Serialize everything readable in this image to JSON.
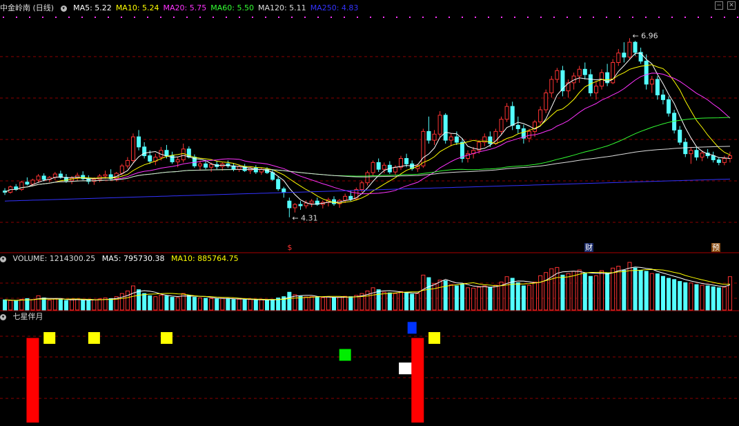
{
  "price_panel": {
    "title": "中金岭南 (日线)",
    "indicators": [
      {
        "label": "MA5: 5.22",
        "color": "#ffffff"
      },
      {
        "label": "MA10: 5.24",
        "color": "#ffff00"
      },
      {
        "label": "MA20: 5.75",
        "color": "#ff33ff"
      },
      {
        "label": "MA60: 5.50",
        "color": "#33ff33"
      },
      {
        "label": "MA120: 5.11",
        "color": "#dddddd"
      },
      {
        "label": "MA250: 4.83",
        "color": "#3333ff"
      }
    ],
    "high_label": "6.96",
    "low_label": "4.31",
    "marker_cai": "财",
    "marker_yu": "预"
  },
  "volume_panel": {
    "title": "VOLUME: 1214300.25",
    "ma5": "MA5: 795730.38",
    "ma10": "MA10: 885764.75"
  },
  "indicator_panel": {
    "title": "七星伴月"
  },
  "colors": {
    "up": "#ff3333",
    "down": "#54ffff",
    "grid": "#8b0000",
    "ma5": "#ffffff",
    "ma10": "#ffff00",
    "ma20": "#ff33ff",
    "ma60": "#33ff33",
    "ma120": "#dddddd",
    "ma250": "#3333ff"
  },
  "chart_data": [
    {
      "type": "candlestick",
      "title": "中金岭南 (日线)",
      "ylim": [
        4.0,
        7.3
      ],
      "annotations": [
        {
          "label": "6.96",
          "value": 6.96
        },
        {
          "label": "4.31",
          "value": 4.31
        }
      ],
      "candles": [
        [
          4.7,
          4.74,
          4.64,
          4.68
        ],
        [
          4.68,
          4.78,
          4.66,
          4.76
        ],
        [
          4.76,
          4.8,
          4.7,
          4.72
        ],
        [
          4.72,
          4.85,
          4.7,
          4.83
        ],
        [
          4.83,
          4.9,
          4.78,
          4.8
        ],
        [
          4.8,
          4.88,
          4.77,
          4.86
        ],
        [
          4.86,
          4.95,
          4.82,
          4.92
        ],
        [
          4.92,
          4.96,
          4.84,
          4.87
        ],
        [
          4.87,
          4.92,
          4.83,
          4.9
        ],
        [
          4.9,
          4.98,
          4.86,
          4.95
        ],
        [
          4.95,
          5.0,
          4.88,
          4.9
        ],
        [
          4.9,
          4.95,
          4.82,
          4.85
        ],
        [
          4.85,
          4.92,
          4.8,
          4.89
        ],
        [
          4.89,
          4.97,
          4.85,
          4.93
        ],
        [
          4.93,
          4.99,
          4.86,
          4.88
        ],
        [
          4.88,
          4.93,
          4.8,
          4.84
        ],
        [
          4.84,
          4.9,
          4.79,
          4.87
        ],
        [
          4.87,
          4.95,
          4.83,
          4.92
        ],
        [
          4.92,
          5.0,
          4.88,
          4.94
        ],
        [
          4.94,
          5.02,
          4.85,
          4.88
        ],
        [
          4.88,
          4.98,
          4.84,
          4.96
        ],
        [
          4.96,
          5.1,
          4.93,
          5.07
        ],
        [
          5.07,
          5.2,
          5.03,
          5.15
        ],
        [
          5.15,
          5.55,
          5.12,
          5.5
        ],
        [
          5.5,
          5.6,
          5.3,
          5.35
        ],
        [
          5.35,
          5.42,
          5.18,
          5.22
        ],
        [
          5.22,
          5.3,
          5.1,
          5.14
        ],
        [
          5.14,
          5.25,
          5.08,
          5.2
        ],
        [
          5.2,
          5.35,
          5.15,
          5.3
        ],
        [
          5.3,
          5.38,
          5.18,
          5.22
        ],
        [
          5.22,
          5.28,
          5.1,
          5.13
        ],
        [
          5.13,
          5.2,
          5.05,
          5.16
        ],
        [
          5.16,
          5.4,
          5.12,
          5.32
        ],
        [
          5.32,
          5.36,
          5.18,
          5.2
        ],
        [
          5.2,
          5.24,
          5.04,
          5.07
        ],
        [
          5.07,
          5.15,
          5.0,
          5.1
        ],
        [
          5.1,
          5.16,
          5.02,
          5.05
        ],
        [
          5.05,
          5.12,
          4.98,
          5.09
        ],
        [
          5.09,
          5.14,
          5.02,
          5.06
        ],
        [
          5.06,
          5.12,
          5.0,
          5.1
        ],
        [
          5.1,
          5.15,
          5.04,
          5.07
        ],
        [
          5.07,
          5.11,
          4.99,
          5.02
        ],
        [
          5.02,
          5.09,
          4.98,
          5.06
        ],
        [
          5.06,
          5.1,
          4.98,
          5.0
        ],
        [
          5.0,
          5.06,
          4.95,
          5.04
        ],
        [
          5.04,
          5.08,
          4.95,
          4.98
        ],
        [
          4.98,
          5.04,
          4.94,
          5.02
        ],
        [
          5.02,
          5.05,
          4.95,
          4.97
        ],
        [
          4.97,
          5.02,
          4.85,
          4.87
        ],
        [
          4.87,
          4.92,
          4.7,
          4.73
        ],
        [
          4.73,
          4.76,
          4.6,
          4.68
        ],
        [
          4.55,
          4.6,
          4.31,
          4.45
        ],
        [
          4.45,
          4.52,
          4.38,
          4.5
        ],
        [
          4.5,
          4.55,
          4.42,
          4.48
        ],
        [
          4.48,
          4.56,
          4.44,
          4.52
        ],
        [
          4.52,
          4.58,
          4.46,
          4.55
        ],
        [
          4.55,
          4.6,
          4.48,
          4.5
        ],
        [
          4.5,
          4.56,
          4.44,
          4.53
        ],
        [
          4.53,
          4.6,
          4.47,
          4.57
        ],
        [
          4.57,
          4.62,
          4.48,
          4.51
        ],
        [
          4.51,
          4.58,
          4.45,
          4.56
        ],
        [
          4.56,
          4.66,
          4.52,
          4.62
        ],
        [
          4.62,
          4.7,
          4.55,
          4.58
        ],
        [
          4.58,
          4.75,
          4.56,
          4.72
        ],
        [
          4.72,
          4.85,
          4.68,
          4.82
        ],
        [
          4.82,
          5.0,
          4.78,
          4.97
        ],
        [
          4.97,
          5.15,
          4.92,
          5.12
        ],
        [
          5.12,
          5.18,
          4.98,
          5.02
        ],
        [
          5.02,
          5.12,
          4.96,
          5.08
        ],
        [
          5.08,
          5.14,
          4.95,
          4.98
        ],
        [
          4.98,
          5.08,
          4.94,
          5.05
        ],
        [
          5.05,
          5.22,
          5.01,
          5.18
        ],
        [
          5.18,
          5.25,
          5.05,
          5.1
        ],
        [
          5.1,
          5.15,
          5.0,
          5.03
        ],
        [
          5.03,
          5.1,
          4.98,
          5.07
        ],
        [
          5.07,
          5.62,
          5.04,
          5.58
        ],
        [
          5.58,
          5.8,
          5.4,
          5.45
        ],
        [
          5.45,
          5.6,
          5.38,
          5.54
        ],
        [
          5.54,
          5.88,
          5.5,
          5.82
        ],
        [
          5.82,
          5.85,
          5.4,
          5.45
        ],
        [
          5.45,
          5.55,
          5.36,
          5.5
        ],
        [
          5.5,
          5.58,
          5.38,
          5.42
        ],
        [
          5.42,
          5.48,
          5.12,
          5.18
        ],
        [
          5.18,
          5.3,
          5.12,
          5.25
        ],
        [
          5.25,
          5.35,
          5.18,
          5.3
        ],
        [
          5.3,
          5.45,
          5.25,
          5.42
        ],
        [
          5.42,
          5.55,
          5.36,
          5.5
        ],
        [
          5.5,
          5.58,
          5.35,
          5.4
        ],
        [
          5.4,
          5.62,
          5.38,
          5.58
        ],
        [
          5.58,
          5.8,
          5.54,
          5.76
        ],
        [
          5.76,
          6.0,
          5.72,
          5.95
        ],
        [
          5.95,
          6.02,
          5.6,
          5.67
        ],
        [
          5.67,
          5.8,
          5.55,
          5.62
        ],
        [
          5.62,
          5.68,
          5.4,
          5.48
        ],
        [
          5.48,
          5.62,
          5.42,
          5.58
        ],
        [
          5.58,
          5.75,
          5.5,
          5.72
        ],
        [
          5.72,
          5.95,
          5.68,
          5.9
        ],
        [
          5.9,
          6.2,
          5.85,
          6.15
        ],
        [
          6.15,
          6.4,
          6.08,
          6.35
        ],
        [
          6.35,
          6.52,
          6.3,
          6.48
        ],
        [
          6.48,
          6.55,
          6.1,
          6.18
        ],
        [
          6.18,
          6.35,
          6.08,
          6.3
        ],
        [
          6.3,
          6.45,
          6.2,
          6.4
        ],
        [
          6.4,
          6.55,
          6.3,
          6.5
        ],
        [
          6.5,
          6.6,
          6.35,
          6.42
        ],
        [
          6.42,
          6.5,
          6.1,
          6.15
        ],
        [
          6.15,
          6.32,
          6.05,
          6.25
        ],
        [
          6.25,
          6.5,
          6.2,
          6.45
        ],
        [
          6.45,
          6.58,
          6.25,
          6.3
        ],
        [
          6.3,
          6.65,
          6.28,
          6.6
        ],
        [
          6.6,
          6.8,
          6.55,
          6.74
        ],
        [
          6.74,
          6.9,
          6.6,
          6.68
        ],
        [
          6.68,
          6.96,
          6.65,
          6.9
        ],
        [
          6.9,
          6.92,
          6.7,
          6.75
        ],
        [
          6.75,
          6.82,
          6.58,
          6.62
        ],
        [
          6.62,
          6.72,
          6.2,
          6.28
        ],
        [
          6.28,
          6.4,
          6.15,
          6.35
        ],
        [
          6.35,
          6.4,
          6.05,
          6.12
        ],
        [
          6.12,
          6.2,
          5.98,
          6.05
        ],
        [
          6.05,
          6.1,
          5.8,
          5.85
        ],
        [
          5.85,
          5.9,
          5.55,
          5.6
        ],
        [
          5.6,
          5.66,
          5.38,
          5.42
        ],
        [
          5.42,
          5.48,
          5.2,
          5.25
        ],
        [
          5.25,
          5.35,
          5.1,
          5.3
        ],
        [
          5.3,
          5.36,
          5.15,
          5.2
        ],
        [
          5.2,
          5.3,
          5.14,
          5.26
        ],
        [
          5.26,
          5.32,
          5.18,
          5.22
        ],
        [
          5.22,
          5.28,
          5.12,
          5.16
        ],
        [
          5.16,
          5.2,
          5.08,
          5.12
        ],
        [
          5.12,
          5.22,
          5.08,
          5.18
        ],
        [
          5.18,
          5.28,
          5.12,
          5.22
        ]
      ],
      "series": [
        {
          "name": "MA5",
          "value": 5.22
        },
        {
          "name": "MA10",
          "value": 5.24
        },
        {
          "name": "MA20",
          "value": 5.75
        },
        {
          "name": "MA60",
          "value": 5.5
        },
        {
          "name": "MA120",
          "value": 5.11
        },
        {
          "name": "MA250",
          "value": 4.83
        }
      ]
    },
    {
      "type": "bar",
      "title": "VOLUME: 1214300.25",
      "ylim": [
        0,
        1500000
      ],
      "series": [
        {
          "name": "MA5",
          "value": 795730.38
        },
        {
          "name": "MA10",
          "value": 885764.75
        }
      ],
      "values": [
        320000,
        300000,
        290000,
        340000,
        360000,
        330000,
        450000,
        380000,
        310000,
        350000,
        330000,
        300000,
        320000,
        340000,
        310000,
        300000,
        320000,
        350000,
        380000,
        360000,
        420000,
        520000,
        600000,
        760000,
        640000,
        520000,
        450000,
        420000,
        470000,
        440000,
        400000,
        390000,
        520000,
        460000,
        400000,
        380000,
        370000,
        360000,
        350000,
        370000,
        360000,
        330000,
        340000,
        320000,
        330000,
        310000,
        320000,
        300000,
        330000,
        380000,
        420000,
        560000,
        480000,
        430000,
        410000,
        420000,
        400000,
        390000,
        410000,
        380000,
        400000,
        430000,
        420000,
        460000,
        520000,
        600000,
        700000,
        640000,
        560000,
        540000,
        520000,
        580000,
        540000,
        500000,
        520000,
        1100000,
        1020000,
        840000,
        940000,
        920000,
        800000,
        760000,
        820000,
        700000,
        690000,
        720000,
        760000,
        720000,
        780000,
        880000,
        1050000,
        1000000,
        860000,
        760000,
        780000,
        880000,
        1080000,
        1180000,
        1300000,
        1340000,
        1100000,
        1150000,
        1220000,
        1260000,
        1150000,
        1060000,
        1080000,
        1240000,
        1160000,
        1320000,
        1380000,
        1250000,
        1500000,
        1320000,
        1250000,
        1220000,
        1150000,
        1140000,
        1060000,
        1000000,
        960000,
        900000,
        860000,
        850000,
        800000,
        780000,
        760000,
        730000,
        700000,
        720000,
        1050000
      ]
    },
    {
      "type": "bar",
      "title": "七星伴月",
      "ylim": [
        0,
        120
      ],
      "points": [
        {
          "x": 5,
          "y": 100,
          "color": "red"
        },
        {
          "x": 8,
          "y": 100,
          "color": "yellow"
        },
        {
          "x": 16,
          "y": 100,
          "color": "yellow"
        },
        {
          "x": 29,
          "y": 100,
          "color": "yellow"
        },
        {
          "x": 61,
          "y": 80,
          "color": "green"
        },
        {
          "x": 72,
          "y": 64,
          "color": "white"
        },
        {
          "x": 73,
          "y": 112,
          "color": "blue"
        },
        {
          "x": 74,
          "y": 100,
          "color": "red"
        },
        {
          "x": 77,
          "y": 100,
          "color": "yellow"
        }
      ]
    }
  ]
}
